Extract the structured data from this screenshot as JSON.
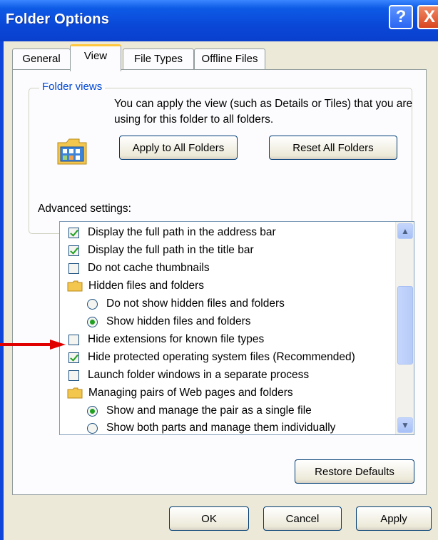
{
  "window": {
    "title": "Folder Options",
    "help_label": "?",
    "close_label": "X"
  },
  "tabs": [
    {
      "label": "General",
      "active": false
    },
    {
      "label": "View",
      "active": true
    },
    {
      "label": "File Types",
      "active": false
    },
    {
      "label": "Offline Files",
      "active": false
    }
  ],
  "folder_views": {
    "legend": "Folder views",
    "description": "You can apply the view (such as Details or Tiles) that you are using for this folder to all folders.",
    "apply_button": "Apply to All Folders",
    "reset_button": "Reset All Folders"
  },
  "advanced": {
    "label": "Advanced settings:",
    "items": [
      {
        "type": "checkbox",
        "checked": true,
        "indent": 0,
        "label": "Display the full path in the address bar"
      },
      {
        "type": "checkbox",
        "checked": true,
        "indent": 0,
        "label": "Display the full path in the title bar"
      },
      {
        "type": "checkbox",
        "checked": false,
        "indent": 0,
        "label": "Do not cache thumbnails"
      },
      {
        "type": "folder",
        "indent": 0,
        "label": "Hidden files and folders"
      },
      {
        "type": "radio",
        "checked": false,
        "indent": 1,
        "label": "Do not show hidden files and folders"
      },
      {
        "type": "radio",
        "checked": true,
        "indent": 1,
        "label": "Show hidden files and folders"
      },
      {
        "type": "checkbox",
        "checked": false,
        "indent": 0,
        "label": "Hide extensions for known file types"
      },
      {
        "type": "checkbox",
        "checked": true,
        "indent": 0,
        "label": "Hide protected operating system files (Recommended)"
      },
      {
        "type": "checkbox",
        "checked": false,
        "indent": 0,
        "label": "Launch folder windows in a separate process"
      },
      {
        "type": "folder",
        "indent": 0,
        "label": "Managing pairs of Web pages and folders"
      },
      {
        "type": "radio",
        "checked": true,
        "indent": 1,
        "label": "Show and manage the pair as a single file"
      },
      {
        "type": "radio",
        "checked": false,
        "indent": 1,
        "label": "Show both parts and manage them individually"
      }
    ],
    "restore_button": "Restore Defaults"
  },
  "footer": {
    "ok_button": "OK",
    "cancel_button": "Cancel",
    "apply_button": "Apply"
  },
  "colors": {
    "annotation_arrow": "#e00000",
    "check_green": "#21a121",
    "title_blue": "#0a48d8"
  }
}
